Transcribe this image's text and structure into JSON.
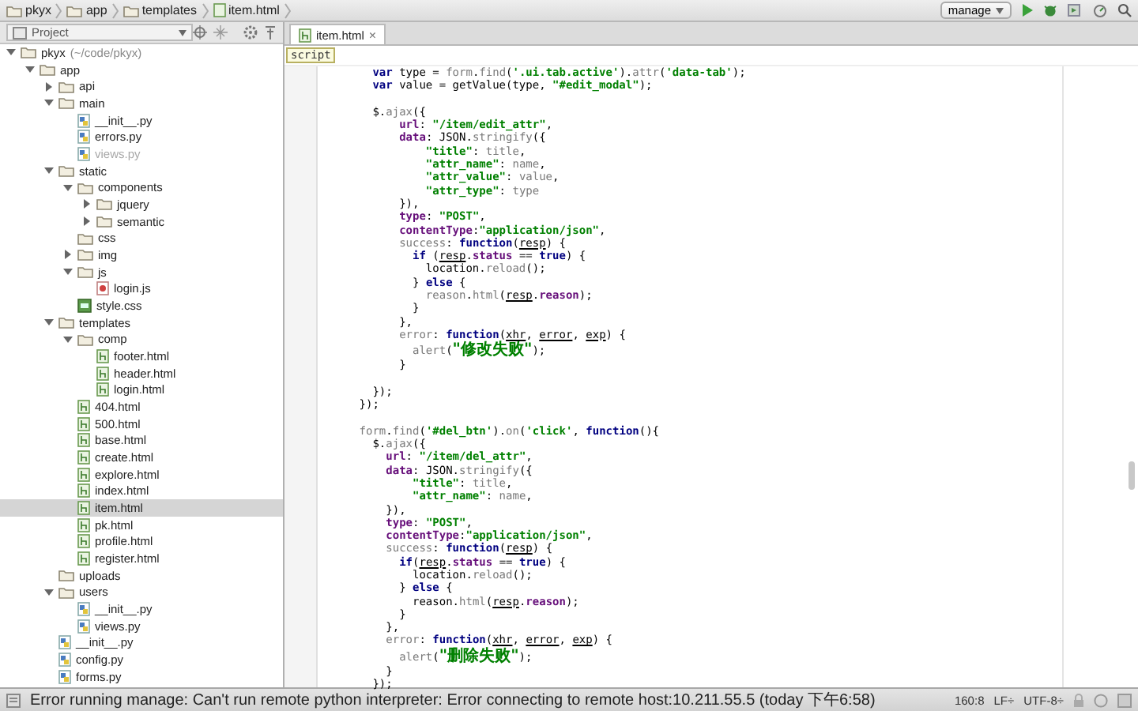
{
  "breadcrumb": [
    "pkyx",
    "app",
    "templates",
    "item.html"
  ],
  "toolbar": {
    "run_config": "manage"
  },
  "project_panel": {
    "title": "Project"
  },
  "tree": [
    {
      "label": "pkyx",
      "suffix": "(~/code/pkyx)",
      "kind": "folder",
      "expanded": true,
      "selected": false,
      "dimmed": false,
      "children": [
        {
          "label": "app",
          "kind": "folder",
          "expanded": true,
          "selected": false,
          "dimmed": false,
          "children": [
            {
              "label": "api",
              "kind": "folder",
              "expanded": false,
              "selected": false,
              "dimmed": false
            },
            {
              "label": "main",
              "kind": "folder",
              "expanded": true,
              "selected": false,
              "dimmed": false,
              "children": [
                {
                  "label": "__init__.py",
                  "kind": "py",
                  "selected": false,
                  "dimmed": false
                },
                {
                  "label": "errors.py",
                  "kind": "py",
                  "selected": false,
                  "dimmed": false
                },
                {
                  "label": "views.py",
                  "kind": "py",
                  "selected": false,
                  "dimmed": true
                }
              ]
            },
            {
              "label": "static",
              "kind": "folder",
              "expanded": true,
              "selected": false,
              "dimmed": false,
              "children": [
                {
                  "label": "components",
                  "kind": "folder",
                  "expanded": true,
                  "selected": false,
                  "dimmed": false,
                  "children": [
                    {
                      "label": "jquery",
                      "kind": "folder",
                      "expanded": false,
                      "selected": false,
                      "dimmed": false
                    },
                    {
                      "label": "semantic",
                      "kind": "folder",
                      "expanded": false,
                      "selected": false,
                      "dimmed": false
                    }
                  ]
                },
                {
                  "label": "css",
                  "kind": "empty-folder",
                  "selected": false,
                  "dimmed": false
                },
                {
                  "label": "img",
                  "kind": "folder",
                  "expanded": false,
                  "selected": false,
                  "dimmed": false
                },
                {
                  "label": "js",
                  "kind": "folder",
                  "expanded": true,
                  "selected": false,
                  "dimmed": false,
                  "children": [
                    {
                      "label": "login.js",
                      "kind": "js",
                      "selected": false,
                      "dimmed": false
                    }
                  ]
                },
                {
                  "label": "style.css",
                  "kind": "css",
                  "selected": false,
                  "dimmed": false
                }
              ]
            },
            {
              "label": "templates",
              "kind": "folder",
              "expanded": true,
              "selected": false,
              "dimmed": false,
              "children": [
                {
                  "label": "comp",
                  "kind": "folder",
                  "expanded": true,
                  "selected": false,
                  "dimmed": false,
                  "children": [
                    {
                      "label": "footer.html",
                      "kind": "html",
                      "selected": false,
                      "dimmed": false
                    },
                    {
                      "label": "header.html",
                      "kind": "html",
                      "selected": false,
                      "dimmed": false
                    },
                    {
                      "label": "login.html",
                      "kind": "html",
                      "selected": false,
                      "dimmed": false
                    }
                  ]
                },
                {
                  "label": "404.html",
                  "kind": "html",
                  "selected": false,
                  "dimmed": false
                },
                {
                  "label": "500.html",
                  "kind": "html",
                  "selected": false,
                  "dimmed": false
                },
                {
                  "label": "base.html",
                  "kind": "html",
                  "selected": false,
                  "dimmed": false
                },
                {
                  "label": "create.html",
                  "kind": "html",
                  "selected": false,
                  "dimmed": false
                },
                {
                  "label": "explore.html",
                  "kind": "html",
                  "selected": false,
                  "dimmed": false
                },
                {
                  "label": "index.html",
                  "kind": "html",
                  "selected": false,
                  "dimmed": false
                },
                {
                  "label": "item.html",
                  "kind": "html",
                  "selected": true,
                  "dimmed": false
                },
                {
                  "label": "pk.html",
                  "kind": "html",
                  "selected": false,
                  "dimmed": false
                },
                {
                  "label": "profile.html",
                  "kind": "html",
                  "selected": false,
                  "dimmed": false
                },
                {
                  "label": "register.html",
                  "kind": "html",
                  "selected": false,
                  "dimmed": false
                }
              ]
            },
            {
              "label": "uploads",
              "kind": "empty-folder",
              "selected": false,
              "dimmed": false
            },
            {
              "label": "users",
              "kind": "folder",
              "expanded": true,
              "selected": false,
              "dimmed": false,
              "children": [
                {
                  "label": "__init__.py",
                  "kind": "py",
                  "selected": false,
                  "dimmed": false
                },
                {
                  "label": "views.py",
                  "kind": "py",
                  "selected": false,
                  "dimmed": false
                }
              ]
            },
            {
              "label": "__init__.py",
              "kind": "py",
              "selected": false,
              "dimmed": false
            },
            {
              "label": "config.py",
              "kind": "py",
              "selected": false,
              "dimmed": false
            },
            {
              "label": "forms.py",
              "kind": "py",
              "selected": false,
              "dimmed": false
            }
          ]
        }
      ]
    }
  ],
  "editor_tabs": [
    {
      "label": "item.html",
      "close": "×",
      "selected": true
    }
  ],
  "scope": "script",
  "code_lines": [
    {
      "kind": "code",
      "segments": [
        {
          "kind": "keyword",
          "text": "        var "
        },
        {
          "kind": "plain",
          "text": "type = "
        },
        {
          "kind": "member",
          "text": "form"
        },
        {
          "kind": "plain",
          "text": "."
        },
        {
          "kind": "member",
          "text": "find"
        },
        {
          "kind": "plain",
          "text": "("
        },
        {
          "kind": "string",
          "text": "'.ui.tab.active'"
        },
        {
          "kind": "plain",
          "text": ")."
        },
        {
          "kind": "member",
          "text": "attr"
        },
        {
          "kind": "plain",
          "text": "("
        },
        {
          "kind": "string",
          "text": "'data-tab'"
        },
        {
          "kind": "plain",
          "text": ");"
        }
      ]
    },
    {
      "kind": "code",
      "segments": [
        {
          "kind": "keyword",
          "text": "        var "
        },
        {
          "kind": "plain",
          "text": "value = getValue(type, "
        },
        {
          "kind": "string",
          "text": "\"#edit_modal\""
        },
        {
          "kind": "plain",
          "text": ");"
        }
      ]
    },
    {
      "kind": "blank"
    },
    {
      "kind": "code",
      "segments": [
        {
          "kind": "plain",
          "text": "        $."
        },
        {
          "kind": "member",
          "text": "ajax"
        },
        {
          "kind": "plain",
          "text": "({"
        }
      ]
    },
    {
      "kind": "code",
      "segments": [
        {
          "kind": "property",
          "text": "            url"
        },
        {
          "kind": "plain",
          "text": ": "
        },
        {
          "kind": "string",
          "text": "\"/item/edit_attr\""
        },
        {
          "kind": "plain",
          "text": ","
        }
      ]
    },
    {
      "kind": "code",
      "segments": [
        {
          "kind": "property",
          "text": "            data"
        },
        {
          "kind": "plain",
          "text": ": JSON."
        },
        {
          "kind": "member",
          "text": "stringify"
        },
        {
          "kind": "plain",
          "text": "({"
        }
      ]
    },
    {
      "kind": "code",
      "segments": [
        {
          "kind": "string",
          "text": "                \"title\""
        },
        {
          "kind": "plain",
          "text": ": "
        },
        {
          "kind": "member",
          "text": "title"
        },
        {
          "kind": "plain",
          "text": ","
        }
      ]
    },
    {
      "kind": "code",
      "segments": [
        {
          "kind": "string",
          "text": "                \"attr_name\""
        },
        {
          "kind": "plain",
          "text": ": "
        },
        {
          "kind": "member",
          "text": "name"
        },
        {
          "kind": "plain",
          "text": ","
        }
      ]
    },
    {
      "kind": "code",
      "segments": [
        {
          "kind": "string",
          "text": "                \"attr_value\""
        },
        {
          "kind": "plain",
          "text": ": "
        },
        {
          "kind": "member",
          "text": "value"
        },
        {
          "kind": "plain",
          "text": ","
        }
      ]
    },
    {
      "kind": "code",
      "segments": [
        {
          "kind": "string",
          "text": "                \"attr_type\""
        },
        {
          "kind": "plain",
          "text": ": "
        },
        {
          "kind": "member",
          "text": "type"
        }
      ]
    },
    {
      "kind": "code",
      "segments": [
        {
          "kind": "plain",
          "text": "            }),"
        }
      ]
    },
    {
      "kind": "code",
      "segments": [
        {
          "kind": "property",
          "text": "            type"
        },
        {
          "kind": "plain",
          "text": ": "
        },
        {
          "kind": "string",
          "text": "\"POST\""
        },
        {
          "kind": "plain",
          "text": ","
        }
      ]
    },
    {
      "kind": "code",
      "segments": [
        {
          "kind": "property",
          "text": "            contentType"
        },
        {
          "kind": "plain",
          "text": ":"
        },
        {
          "kind": "string",
          "text": "\"application/json\""
        },
        {
          "kind": "plain",
          "text": ","
        }
      ]
    },
    {
      "kind": "code",
      "segments": [
        {
          "kind": "member",
          "text": "            success"
        },
        {
          "kind": "plain",
          "text": ": "
        },
        {
          "kind": "keyword",
          "text": "function"
        },
        {
          "kind": "plain",
          "text": "("
        },
        {
          "kind": "param",
          "text": "resp"
        },
        {
          "kind": "plain",
          "text": ") {"
        }
      ]
    },
    {
      "kind": "code",
      "segments": [
        {
          "kind": "keyword",
          "text": "              if "
        },
        {
          "kind": "plain",
          "text": "("
        },
        {
          "kind": "param",
          "text": "resp"
        },
        {
          "kind": "plain",
          "text": "."
        },
        {
          "kind": "property",
          "text": "status"
        },
        {
          "kind": "plain",
          "text": " == "
        },
        {
          "kind": "keyword",
          "text": "true"
        },
        {
          "kind": "plain",
          "text": ") {"
        }
      ]
    },
    {
      "kind": "code",
      "segments": [
        {
          "kind": "plain",
          "text": "                location."
        },
        {
          "kind": "member",
          "text": "reload"
        },
        {
          "kind": "plain",
          "text": "();"
        }
      ]
    },
    {
      "kind": "code",
      "segments": [
        {
          "kind": "plain",
          "text": "              } "
        },
        {
          "kind": "keyword",
          "text": "else"
        },
        {
          "kind": "plain",
          "text": " {"
        }
      ]
    },
    {
      "kind": "code",
      "segments": [
        {
          "kind": "member",
          "text": "                reason"
        },
        {
          "kind": "plain",
          "text": "."
        },
        {
          "kind": "member",
          "text": "html"
        },
        {
          "kind": "plain",
          "text": "("
        },
        {
          "kind": "param",
          "text": "resp"
        },
        {
          "kind": "plain",
          "text": "."
        },
        {
          "kind": "property",
          "text": "reason"
        },
        {
          "kind": "plain",
          "text": ");"
        }
      ]
    },
    {
      "kind": "code",
      "segments": [
        {
          "kind": "plain",
          "text": "              }"
        }
      ]
    },
    {
      "kind": "code",
      "segments": [
        {
          "kind": "plain",
          "text": "            },"
        }
      ]
    },
    {
      "kind": "code",
      "segments": [
        {
          "kind": "member",
          "text": "            error"
        },
        {
          "kind": "plain",
          "text": ": "
        },
        {
          "kind": "keyword",
          "text": "function"
        },
        {
          "kind": "plain",
          "text": "("
        },
        {
          "kind": "param",
          "text": "xhr"
        },
        {
          "kind": "plain",
          "text": ", "
        },
        {
          "kind": "param",
          "text": "error"
        },
        {
          "kind": "plain",
          "text": ", "
        },
        {
          "kind": "param",
          "text": "exp"
        },
        {
          "kind": "plain",
          "text": ") {"
        }
      ]
    },
    {
      "kind": "code",
      "segments": [
        {
          "kind": "member",
          "text": "              alert"
        },
        {
          "kind": "plain",
          "text": "("
        },
        {
          "kind": "string",
          "text": "\"修改失败\""
        },
        {
          "kind": "plain",
          "text": ");"
        }
      ]
    },
    {
      "kind": "code",
      "segments": [
        {
          "kind": "plain",
          "text": "            }"
        }
      ]
    },
    {
      "kind": "blank"
    },
    {
      "kind": "code",
      "segments": [
        {
          "kind": "plain",
          "text": "        });"
        }
      ]
    },
    {
      "kind": "code",
      "segments": [
        {
          "kind": "plain",
          "text": "      });"
        }
      ]
    },
    {
      "kind": "blank"
    },
    {
      "kind": "code",
      "segments": [
        {
          "kind": "member",
          "text": "      form"
        },
        {
          "kind": "plain",
          "text": "."
        },
        {
          "kind": "member",
          "text": "find"
        },
        {
          "kind": "plain",
          "text": "("
        },
        {
          "kind": "string",
          "text": "'#del_btn'"
        },
        {
          "kind": "plain",
          "text": ")."
        },
        {
          "kind": "member",
          "text": "on"
        },
        {
          "kind": "plain",
          "text": "("
        },
        {
          "kind": "string",
          "text": "'click'"
        },
        {
          "kind": "plain",
          "text": ", "
        },
        {
          "kind": "keyword",
          "text": "function"
        },
        {
          "kind": "plain",
          "text": "(){"
        }
      ]
    },
    {
      "kind": "code",
      "segments": [
        {
          "kind": "plain",
          "text": "        $."
        },
        {
          "kind": "member",
          "text": "ajax"
        },
        {
          "kind": "plain",
          "text": "({"
        }
      ]
    },
    {
      "kind": "code",
      "segments": [
        {
          "kind": "property",
          "text": "          url"
        },
        {
          "kind": "plain",
          "text": ": "
        },
        {
          "kind": "string",
          "text": "\"/item/del_attr\""
        },
        {
          "kind": "plain",
          "text": ","
        }
      ]
    },
    {
      "kind": "code",
      "segments": [
        {
          "kind": "property",
          "text": "          data"
        },
        {
          "kind": "plain",
          "text": ": JSON."
        },
        {
          "kind": "member",
          "text": "stringify"
        },
        {
          "kind": "plain",
          "text": "({"
        }
      ]
    },
    {
      "kind": "code",
      "segments": [
        {
          "kind": "string",
          "text": "              \"title\""
        },
        {
          "kind": "plain",
          "text": ": "
        },
        {
          "kind": "member",
          "text": "title"
        },
        {
          "kind": "plain",
          "text": ","
        }
      ]
    },
    {
      "kind": "code",
      "segments": [
        {
          "kind": "string",
          "text": "              \"attr_name\""
        },
        {
          "kind": "plain",
          "text": ": "
        },
        {
          "kind": "member",
          "text": "name"
        },
        {
          "kind": "plain",
          "text": ","
        }
      ]
    },
    {
      "kind": "code",
      "segments": [
        {
          "kind": "plain",
          "text": "          }),"
        }
      ]
    },
    {
      "kind": "code",
      "segments": [
        {
          "kind": "property",
          "text": "          type"
        },
        {
          "kind": "plain",
          "text": ": "
        },
        {
          "kind": "string",
          "text": "\"POST\""
        },
        {
          "kind": "plain",
          "text": ","
        }
      ]
    },
    {
      "kind": "code",
      "segments": [
        {
          "kind": "property",
          "text": "          contentType"
        },
        {
          "kind": "plain",
          "text": ":"
        },
        {
          "kind": "string",
          "text": "\"application/json\""
        },
        {
          "kind": "plain",
          "text": ","
        }
      ]
    },
    {
      "kind": "code",
      "segments": [
        {
          "kind": "member",
          "text": "          success"
        },
        {
          "kind": "plain",
          "text": ": "
        },
        {
          "kind": "keyword",
          "text": "function"
        },
        {
          "kind": "plain",
          "text": "("
        },
        {
          "kind": "param",
          "text": "resp"
        },
        {
          "kind": "plain",
          "text": ") {"
        }
      ]
    },
    {
      "kind": "code",
      "segments": [
        {
          "kind": "keyword",
          "text": "            if"
        },
        {
          "kind": "plain",
          "text": "("
        },
        {
          "kind": "param",
          "text": "resp"
        },
        {
          "kind": "plain",
          "text": "."
        },
        {
          "kind": "property",
          "text": "status"
        },
        {
          "kind": "plain",
          "text": " == "
        },
        {
          "kind": "keyword",
          "text": "true"
        },
        {
          "kind": "plain",
          "text": ") {"
        }
      ]
    },
    {
      "kind": "code",
      "segments": [
        {
          "kind": "plain",
          "text": "              location."
        },
        {
          "kind": "member",
          "text": "reload"
        },
        {
          "kind": "plain",
          "text": "();"
        }
      ]
    },
    {
      "kind": "code",
      "segments": [
        {
          "kind": "plain",
          "text": "            } "
        },
        {
          "kind": "keyword",
          "text": "else"
        },
        {
          "kind": "plain",
          "text": " {"
        }
      ]
    },
    {
      "kind": "code",
      "segments": [
        {
          "kind": "plain",
          "text": "              reason."
        },
        {
          "kind": "member",
          "text": "html"
        },
        {
          "kind": "plain",
          "text": "("
        },
        {
          "kind": "param",
          "text": "resp"
        },
        {
          "kind": "plain",
          "text": "."
        },
        {
          "kind": "property",
          "text": "reason"
        },
        {
          "kind": "plain",
          "text": ");"
        }
      ]
    },
    {
      "kind": "code",
      "segments": [
        {
          "kind": "plain",
          "text": "            }"
        }
      ]
    },
    {
      "kind": "code",
      "segments": [
        {
          "kind": "plain",
          "text": "          },"
        }
      ]
    },
    {
      "kind": "code",
      "segments": [
        {
          "kind": "member",
          "text": "          error"
        },
        {
          "kind": "plain",
          "text": ": "
        },
        {
          "kind": "keyword",
          "text": "function"
        },
        {
          "kind": "plain",
          "text": "("
        },
        {
          "kind": "param",
          "text": "xhr"
        },
        {
          "kind": "plain",
          "text": ", "
        },
        {
          "kind": "param",
          "text": "error"
        },
        {
          "kind": "plain",
          "text": ", "
        },
        {
          "kind": "param",
          "text": "exp"
        },
        {
          "kind": "plain",
          "text": ") {"
        }
      ]
    },
    {
      "kind": "code",
      "segments": [
        {
          "kind": "member",
          "text": "            alert"
        },
        {
          "kind": "plain",
          "text": "("
        },
        {
          "kind": "string",
          "text": "\"删除失败\""
        },
        {
          "kind": "plain",
          "text": ");"
        }
      ]
    },
    {
      "kind": "code",
      "segments": [
        {
          "kind": "plain",
          "text": "          }"
        }
      ]
    },
    {
      "kind": "code",
      "segments": [
        {
          "kind": "plain",
          "text": "        });"
        }
      ]
    }
  ],
  "status_bar": {
    "message": "Error running manage: Can't run remote python interpreter: Error connecting to remote host:10.211.55.5 (today 下午6:58)",
    "position": "160:8",
    "line_separator": "LF÷",
    "encoding": "UTF-8÷"
  }
}
